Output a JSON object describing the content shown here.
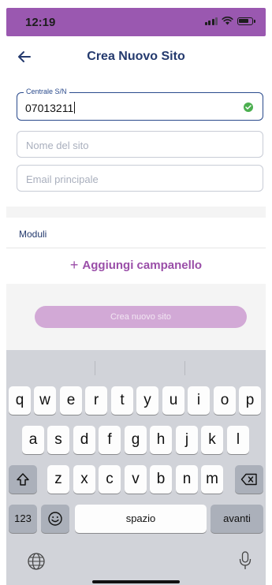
{
  "status_bar": {
    "time": "12:19",
    "signal_icon": "cellular-signal-icon",
    "wifi_icon": "wifi-icon",
    "battery_icon": "battery-icon",
    "background_color": "#9a58b0"
  },
  "header": {
    "title": "Crea Nuovo Sito",
    "back_icon": "arrow-left-icon"
  },
  "form": {
    "serial": {
      "label": "Centrale S/N",
      "value": "07013211",
      "status_icon": "check-circle-icon",
      "status_color": "#4caf50"
    },
    "site_name": {
      "placeholder": "Nome del sito"
    },
    "primary_email": {
      "placeholder": "Email principale"
    }
  },
  "modules": {
    "label": "Moduli",
    "add_plus": "+",
    "add_label": "Aggiungi campanello",
    "accent_color": "#9a4ea8"
  },
  "submit": {
    "label": "Crea nuovo sito",
    "background_color": "#d2a9d6"
  },
  "keyboard": {
    "row1": [
      "q",
      "w",
      "e",
      "r",
      "t",
      "y",
      "u",
      "i",
      "o",
      "p"
    ],
    "row2": [
      "a",
      "s",
      "d",
      "f",
      "g",
      "h",
      "j",
      "k",
      "l"
    ],
    "row3": [
      "z",
      "x",
      "c",
      "v",
      "b",
      "n",
      "m"
    ],
    "shift_icon": "shift-icon",
    "delete_icon": "backspace-icon",
    "numbers_label": "123",
    "emoji_icon": "emoji-icon",
    "space_label": "spazio",
    "return_label": "avanti",
    "globe_icon": "globe-icon",
    "mic_icon": "microphone-icon"
  }
}
